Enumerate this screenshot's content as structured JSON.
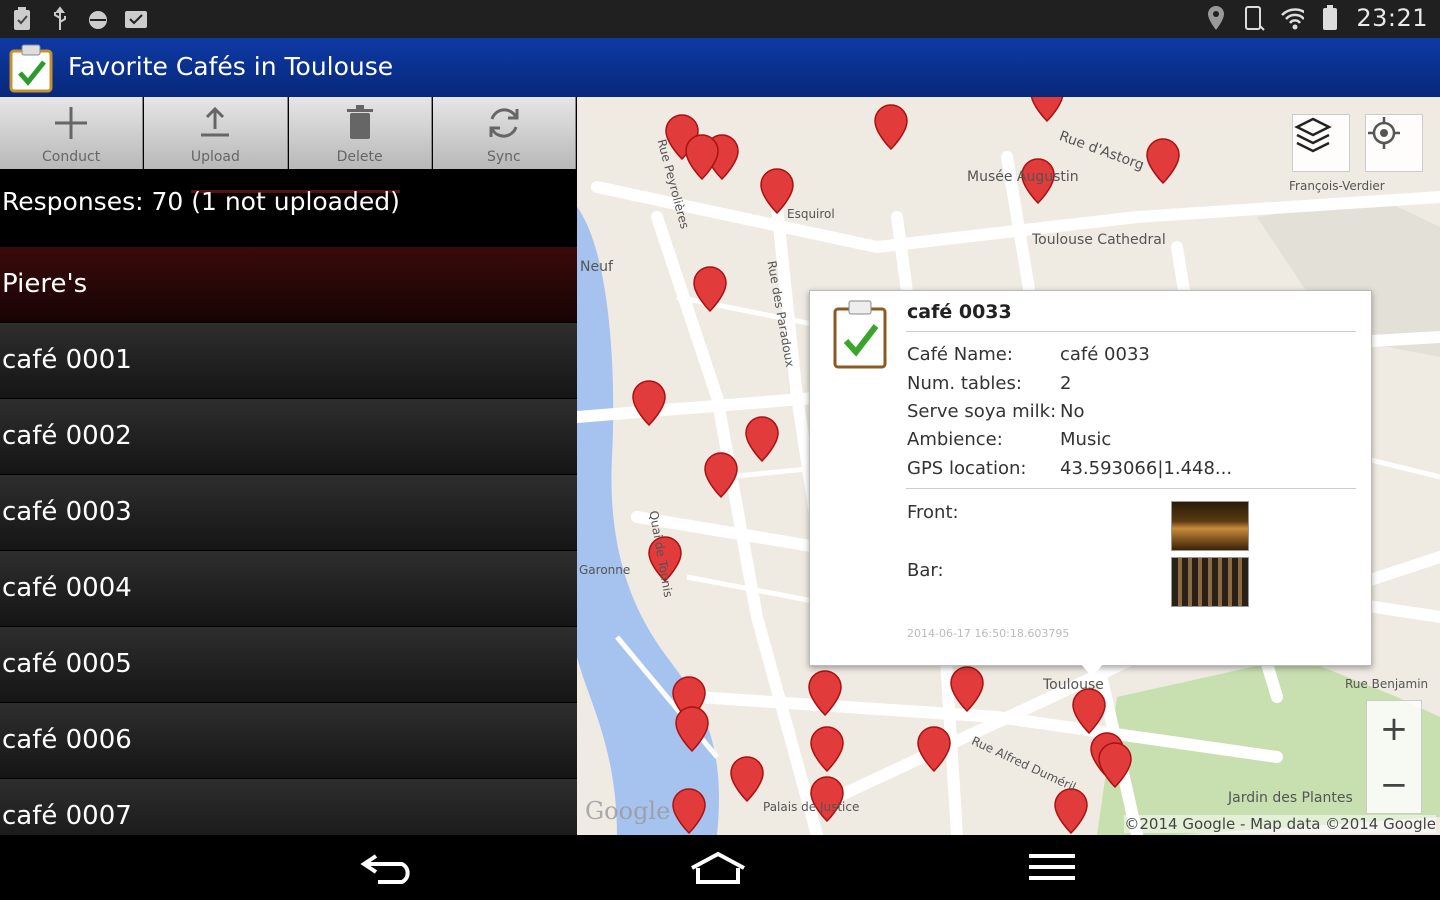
{
  "status_bar": {
    "clock": "23:21"
  },
  "app": {
    "title": "Favorite Cafés in Toulouse"
  },
  "toolbar": {
    "buttons": [
      "Conduct",
      "Upload",
      "Delete",
      "Sync"
    ]
  },
  "responses": {
    "count_label": "Responses: 70",
    "pending_label": "(1 not uploaded)"
  },
  "list": {
    "items": [
      "Piere's",
      "café 0001",
      "café 0002",
      "café 0003",
      "café 0004",
      "café 0005",
      "café 0006",
      "café 0007"
    ],
    "selected_index": 0
  },
  "map": {
    "labels": [
      "Musée Augustin",
      "Rue d'Astorg",
      "Toulouse Cathedral",
      "François-Verdier",
      "Neuf",
      "Rue des Paradoux",
      "Rue Peyrolières",
      "Quai de Tounis",
      "Palais de Justice",
      "Rue Alfred Duméril",
      "Jardin des Plantes",
      "Rue Benjamin",
      "Toulouse",
      "Esquirol",
      "Garonne"
    ],
    "copyright": "©2014 Google - Map data ©2014 Google",
    "logo": "Google",
    "zoom_in": "+",
    "zoom_out": "−"
  },
  "popup": {
    "title": "café 0033",
    "fields": [
      {
        "label": "Café Name:",
        "value": "café 0033"
      },
      {
        "label": "Num. tables:",
        "value": "2"
      },
      {
        "label": "Serve soya milk:",
        "value": "No"
      },
      {
        "label": "Ambience:",
        "value": "Music"
      },
      {
        "label": "GPS location:",
        "value": "43.593066|1.448..."
      }
    ],
    "photos": [
      {
        "label": "Front:"
      },
      {
        "label": "Bar:"
      }
    ],
    "timestamp": "2014-06-17 16:50:18.603795"
  },
  "colors": {
    "appbar": "#0e3aa6",
    "pin": "#e23b3b",
    "selected_row": "#3a0a0a"
  }
}
